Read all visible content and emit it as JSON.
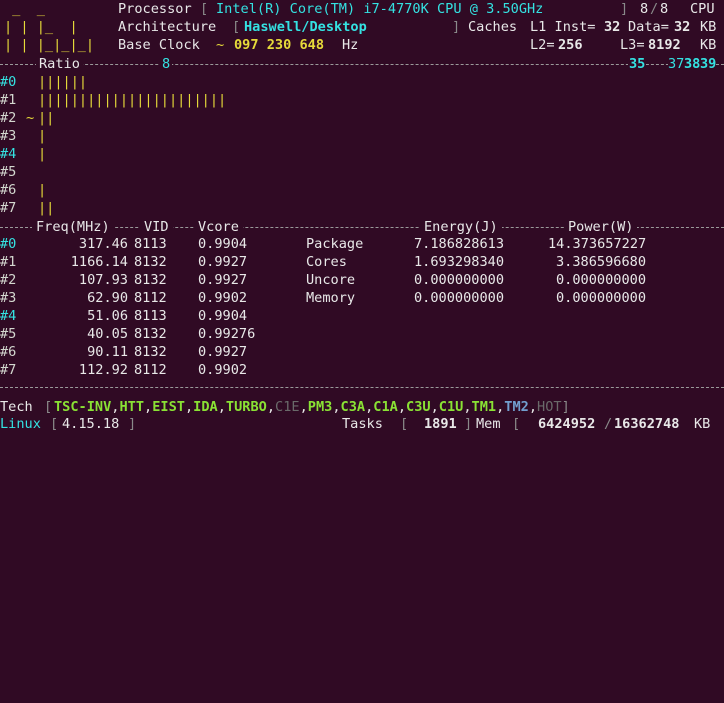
{
  "logo": [
    " _  _",
    "| | |_  |",
    "| | |_|_|_|"
  ],
  "processor": {
    "label": "Processor",
    "value": "Intel(R) Core(TM) i7-4770K CPU @ 3.50GHz",
    "cpu_online": "8",
    "cpu_total": "8",
    "cpu_label": "CPU"
  },
  "architecture": {
    "label": "Architecture",
    "value": "Haswell/Desktop",
    "caches_label": "Caches",
    "l1_inst_label": "L1 Inst=",
    "l1_inst": "32",
    "l1_data_label": "Data=",
    "l1_data": "32",
    "l1_unit": "KB"
  },
  "base_clock": {
    "label": "Base Clock",
    "prefix": "~",
    "value": "097 230 648",
    "unit": "Hz",
    "l2_label": "L2=",
    "l2": "256",
    "l3_label": "L3=",
    "l3": "8192",
    "l3_unit": "KB"
  },
  "ratio_header": {
    "label": "Ratio",
    "mark_min": "8",
    "mark_max_1": "35",
    "mark_max_2": "37",
    "mark_max_3": "38",
    "mark_max_4": "39"
  },
  "ratio_rows": [
    {
      "core": "#0",
      "bars": "||||||"
    },
    {
      "core": "#1",
      "bars": "|||||||||||||||||||||||"
    },
    {
      "core": "#2",
      "prefix": "~",
      "bars": "||"
    },
    {
      "core": "#3",
      "bars": "|"
    },
    {
      "core": "#4",
      "bars": "|"
    },
    {
      "core": "#5",
      "bars": ""
    },
    {
      "core": "#6",
      "bars": "|"
    },
    {
      "core": "#7",
      "bars": "||"
    }
  ],
  "table_header": {
    "freq": "Freq(MHz)",
    "vid": "VID",
    "vcore": "Vcore",
    "energy": "Energy(J)",
    "power": "Power(W)"
  },
  "cores": [
    {
      "core": "#0",
      "freq": "317.46",
      "vid": "8113",
      "vcore": "0.9904"
    },
    {
      "core": "#1",
      "freq": "1166.14",
      "vid": "8132",
      "vcore": "0.9927"
    },
    {
      "core": "#2",
      "freq": "107.93",
      "vid": "8132",
      "vcore": "0.9927"
    },
    {
      "core": "#3",
      "freq": "62.90",
      "vid": "8112",
      "vcore": "0.9902"
    },
    {
      "core": "#4",
      "freq": "51.06",
      "vid": "8113",
      "vcore": "0.9904"
    },
    {
      "core": "#5",
      "freq": "40.05",
      "vid": "8132",
      "vcore": "0.99276"
    },
    {
      "core": "#6",
      "freq": "90.11",
      "vid": "8132",
      "vcore": "0.9927"
    },
    {
      "core": "#7",
      "freq": "112.92",
      "vid": "8112",
      "vcore": "0.9902"
    }
  ],
  "power_domains": [
    {
      "name": "Package",
      "energy": "7.186828613",
      "power": "14.373657227"
    },
    {
      "name": "Cores",
      "energy": "1.693298340",
      "power": "3.386596680"
    },
    {
      "name": "Uncore",
      "energy": "0.000000000",
      "power": "0.000000000"
    },
    {
      "name": "Memory",
      "energy": "0.000000000",
      "power": "0.000000000"
    }
  ],
  "tech": {
    "label": "Tech",
    "flags": [
      {
        "name": "TSC-INV",
        "state": "on"
      },
      {
        "name": "HTT",
        "state": "on"
      },
      {
        "name": "EIST",
        "state": "on"
      },
      {
        "name": "IDA",
        "state": "on"
      },
      {
        "name": "TURBO",
        "state": "on"
      },
      {
        "name": "C1E",
        "state": "off"
      },
      {
        "name": "PM3",
        "state": "on"
      },
      {
        "name": "C3A",
        "state": "on"
      },
      {
        "name": "C1A",
        "state": "on"
      },
      {
        "name": "C3U",
        "state": "on"
      },
      {
        "name": "C1U",
        "state": "on"
      },
      {
        "name": "TM1",
        "state": "on"
      },
      {
        "name": "TM2",
        "state": "alt"
      },
      {
        "name": "HOT",
        "state": "off"
      }
    ]
  },
  "status": {
    "os": "Linux",
    "kernel": "4.15.18",
    "tasks_label": "Tasks",
    "tasks": "1891",
    "mem_label": "Mem",
    "mem_used": "6424952",
    "mem_total": "16362748",
    "mem_unit": "KB"
  },
  "colors": {
    "background": "#300a24",
    "cyan": "#34e2e2",
    "yellow": "#e6db3a",
    "green": "#8ae234",
    "blue": "#729fcf",
    "gray": "#8a8a8a"
  }
}
